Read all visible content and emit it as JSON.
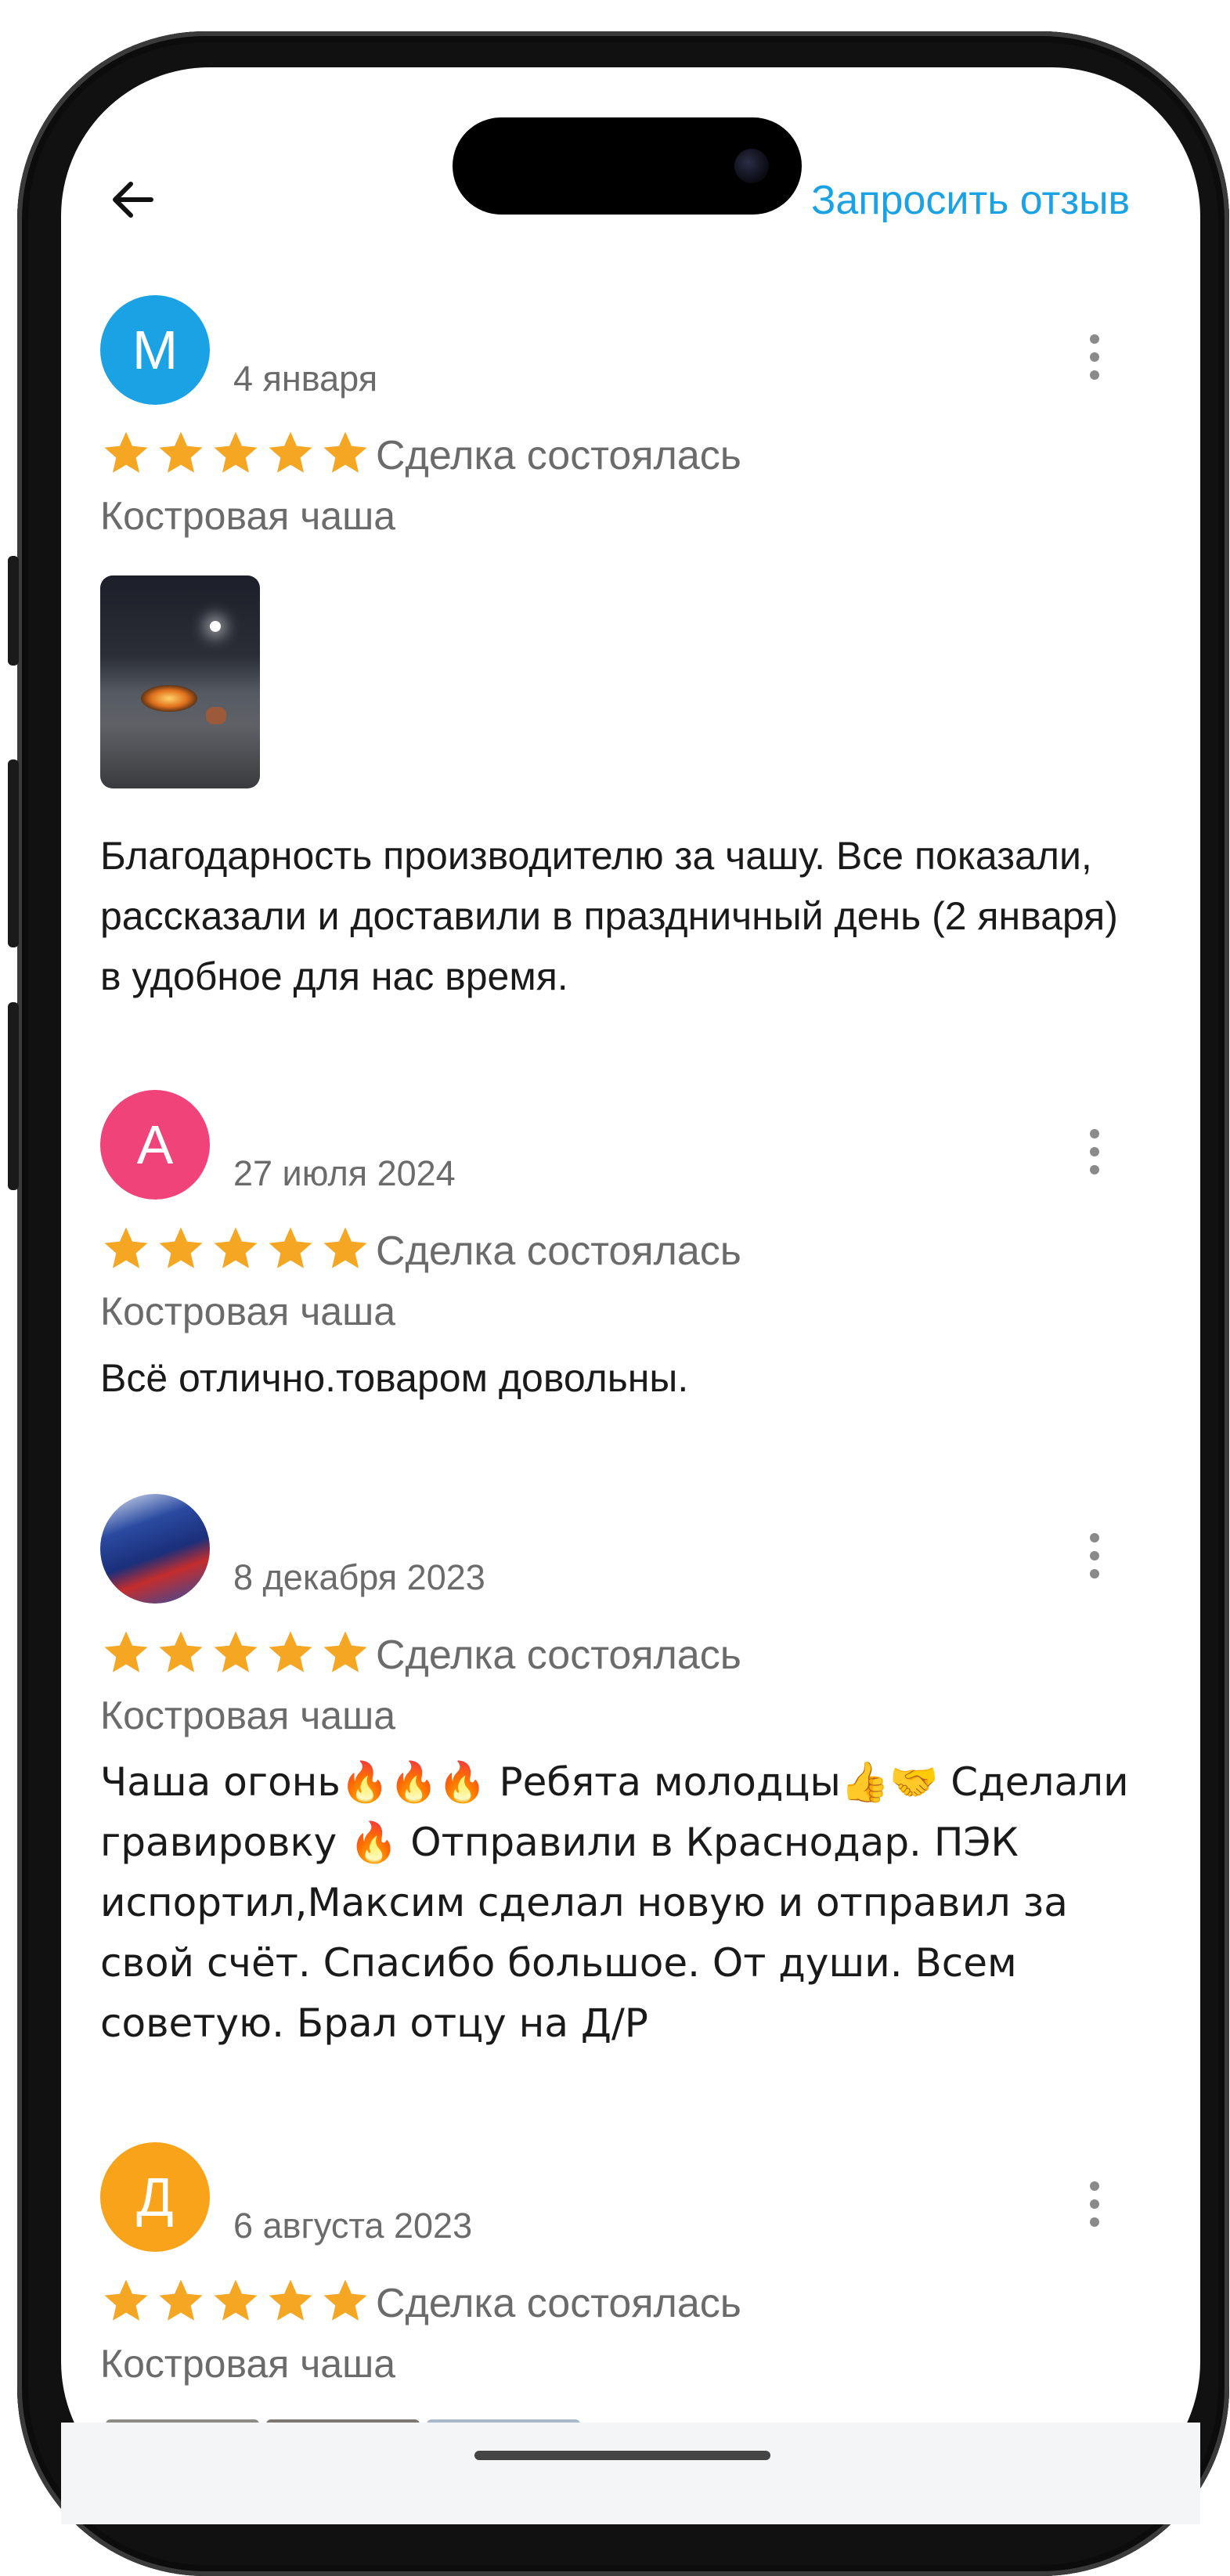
{
  "header": {
    "request_review_label": "Запросить отзыв"
  },
  "icons": {
    "back": "back-arrow-icon",
    "more": "more-vertical-icon",
    "star": "star-icon"
  },
  "colors": {
    "accent": "#1aa2e5",
    "star": "#f5a623",
    "text_secondary": "#6b6b6b",
    "text_primary": "#1a1a1a"
  },
  "reviews": [
    {
      "avatar_letter": "М",
      "avatar_color": "#1aa2e5",
      "date": "4 января",
      "rating": 5,
      "deal_status": "Сделка состоялась",
      "product": "Костровая чаша",
      "has_photo": true,
      "text": "Благодарность производителю за чашу. Все показали, рассказали и доставили в праздничный день (2 января) в удобное для нас время."
    },
    {
      "avatar_letter": "А",
      "avatar_color": "#f0437a",
      "date": "27 июля 2024",
      "rating": 5,
      "deal_status": "Сделка состоялась",
      "product": "Костровая чаша",
      "text": "Всё отлично.товаром довольны."
    },
    {
      "avatar_letter": "",
      "avatar_is_image": true,
      "date": "8 декабря 2023",
      "rating": 5,
      "deal_status": "Сделка состоялась",
      "product": "Костровая чаша",
      "text": "Чаша огонь🔥🔥🔥 Ребята молодцы👍🤝 Сделали гравировку 🔥 Отправили в Краснодар. ПЭК испортил,Максим сделал новую и отправил за свой счёт. Спасибо большое. От души. Всем советую. Брал отцу на Д/Р"
    },
    {
      "avatar_letter": "Д",
      "avatar_color": "#f9a31a",
      "date": "6 августа 2023",
      "rating": 5,
      "deal_status": "Сделка состоялась",
      "product": "Костровая чаша"
    }
  ]
}
